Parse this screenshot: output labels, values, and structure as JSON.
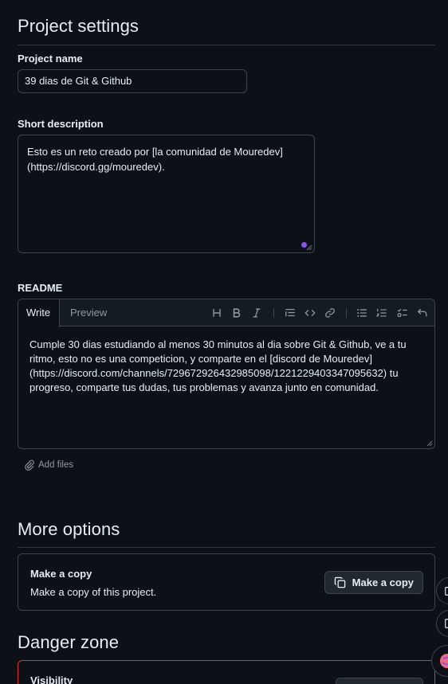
{
  "project_settings": {
    "heading": "Project settings",
    "name_label": "Project name",
    "name_value": "39 dias de Git & Github",
    "description_label": "Short description",
    "description_value": "Esto es un reto creado por [la comunidad de Mouredev](https://discord.gg/mouredev).",
    "readme_label": "README"
  },
  "readme_editor": {
    "tab_write": "Write",
    "tab_preview": "Preview",
    "body": "Cumple 30 dias estudiando al menos 30 minutos al dia sobre Git & Github, ve a tu ritmo, esto no es una competicion, y comparte en el [discord de Mouredev](https://discord.com/channels/729672926432985098/1221229403347095632) tu progreso, comparte tus dudas, tus problemas y avanza junto en comunidad.",
    "attach_label": "Add files",
    "toolbar": [
      "heading-icon",
      "bold-icon",
      "italic-icon",
      "quote-icon",
      "code-icon",
      "link-icon",
      "bulleted-list-icon",
      "numbered-list-icon",
      "task-list-icon",
      "undo-icon"
    ]
  },
  "more_options": {
    "heading": "More options",
    "copy_title": "Make a copy",
    "copy_description": "Make a copy of this project.",
    "copy_button": "Make a copy"
  },
  "danger_zone": {
    "heading": "Danger zone",
    "visibility_title": "Visibility"
  },
  "colors": {
    "background": "#0d1117",
    "border": "#3d444d",
    "danger_border": "#da3633",
    "accent_purple": "#8957e5"
  }
}
